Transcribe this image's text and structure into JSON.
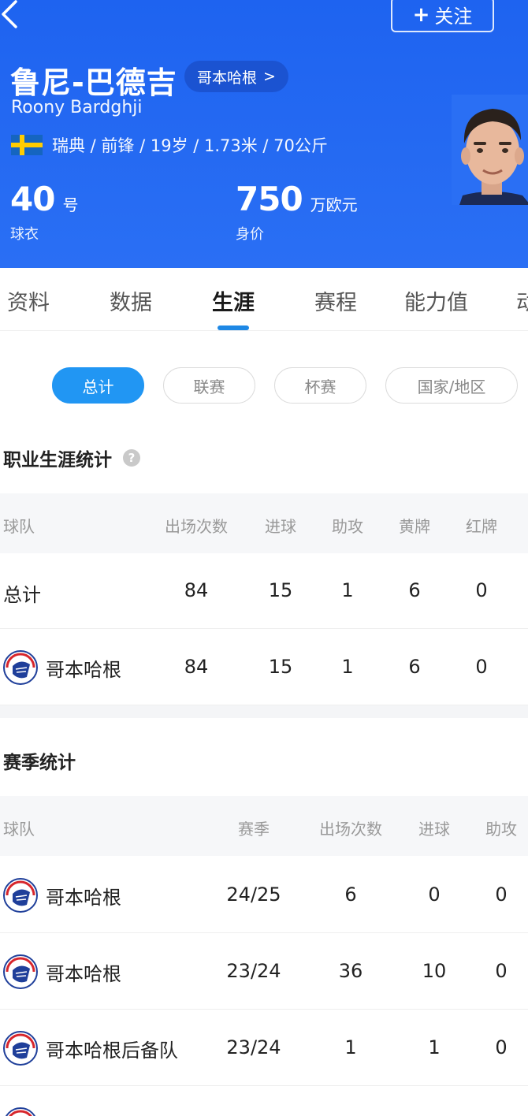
{
  "header": {
    "follow_label": "关注",
    "name_cn": "鲁尼-巴德吉",
    "club_link": "哥本哈根",
    "club_arrow": ">",
    "name_en": "Roony Bardghji",
    "bio": "瑞典 / 前锋 / 19岁 / 1.73米 / 70公斤",
    "jersey_number": "40",
    "jersey_unit": "号",
    "jersey_label": "球衣",
    "value": "750",
    "value_unit": "万欧元",
    "value_label": "身价"
  },
  "tabs": [
    "资料",
    "数据",
    "生涯",
    "赛程",
    "能力值",
    "动"
  ],
  "active_tab": "生涯",
  "filters": [
    "总计",
    "联赛",
    "杯赛",
    "国家/地区"
  ],
  "active_filter": "总计",
  "career": {
    "title": "职业生涯统计",
    "headers": [
      "球队",
      "出场次数",
      "进球",
      "助攻",
      "黄牌",
      "红牌"
    ],
    "rows": [
      {
        "team": "总计",
        "apps": "84",
        "goals": "15",
        "assists": "1",
        "yellow": "6",
        "red": "0"
      },
      {
        "team": "哥本哈根",
        "apps": "84",
        "goals": "15",
        "assists": "1",
        "yellow": "6",
        "red": "0"
      }
    ]
  },
  "season": {
    "title": "赛季统计",
    "headers": [
      "球队",
      "赛季",
      "出场次数",
      "进球",
      "助攻"
    ],
    "rows": [
      {
        "team": "哥本哈根",
        "season": "24/25",
        "apps": "6",
        "goals": "0",
        "assists": "0"
      },
      {
        "team": "哥本哈根",
        "season": "23/24",
        "apps": "36",
        "goals": "10",
        "assists": "0"
      },
      {
        "team": "哥本哈根后备队",
        "season": "23/24",
        "apps": "1",
        "goals": "1",
        "assists": "0"
      }
    ]
  },
  "colors": {
    "header_blue": "#1e63f0",
    "accent_blue": "#2196f3",
    "club_logo_blue": "#1f3f9a",
    "club_logo_red": "#d7262c"
  },
  "icons": {
    "back": "chevron-left-icon",
    "help": "question-circle-icon",
    "flag": "sweden-flag-icon",
    "club_logo": "fc-copenhagen-logo-icon"
  }
}
